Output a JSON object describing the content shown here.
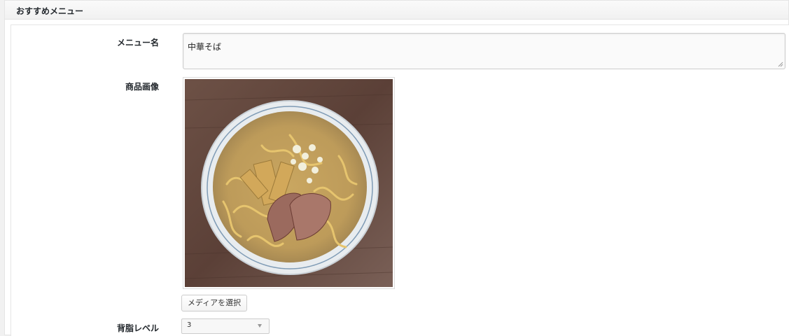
{
  "panel": {
    "title": "おすすめメニュー"
  },
  "fields": {
    "menu_name": {
      "label": "メニュー名",
      "value": "中華そば"
    },
    "product_image": {
      "label": "商品画像",
      "button_label": "メディアを選択"
    },
    "fat_level": {
      "label": "背脂レベル",
      "selected": "3"
    }
  }
}
